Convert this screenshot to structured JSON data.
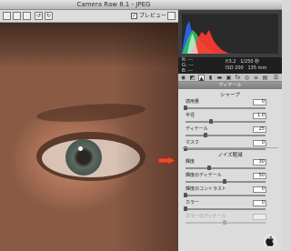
{
  "window": {
    "title": "Camera Raw 8.1 - JPEG"
  },
  "toolbar": {
    "preview_label": "プレビュー",
    "preview_checked": "✓"
  },
  "histogram": {
    "colors": [
      "#ff3b30",
      "#34c759",
      "#2b6bff",
      "#ffffff"
    ]
  },
  "readout": {
    "r_label": "R:",
    "g_label": "G:",
    "b_label": "B:",
    "r_value": "---",
    "g_value": "---",
    "b_value": "---",
    "aperture": "f/3.2",
    "shutter": "1/250 秒",
    "iso": "ISO 200",
    "focal": "135 mm"
  },
  "panel": {
    "title": "ディテール",
    "sharpen": {
      "title": "シャープ",
      "items": [
        {
          "label": "適用量",
          "value": "0",
          "level": 0.0
        },
        {
          "label": "半径",
          "value": "1.0",
          "level": 0.33
        },
        {
          "label": "ディテール",
          "value": "25",
          "level": 0.25
        },
        {
          "label": "マスク",
          "value": "0",
          "level": 0.0
        }
      ]
    },
    "noise": {
      "title": "ノイズ軽減",
      "items": [
        {
          "label": "輝度",
          "value": "30",
          "level": 0.3
        },
        {
          "label": "輝度のディテール",
          "value": "50",
          "level": 0.5
        },
        {
          "label": "輝度のコントラスト",
          "value": "0",
          "level": 0.0
        },
        {
          "label": "カラー",
          "value": "0",
          "level": 0.0
        },
        {
          "label": "カラーのディテール",
          "value": "",
          "level": 0.5
        }
      ]
    }
  }
}
